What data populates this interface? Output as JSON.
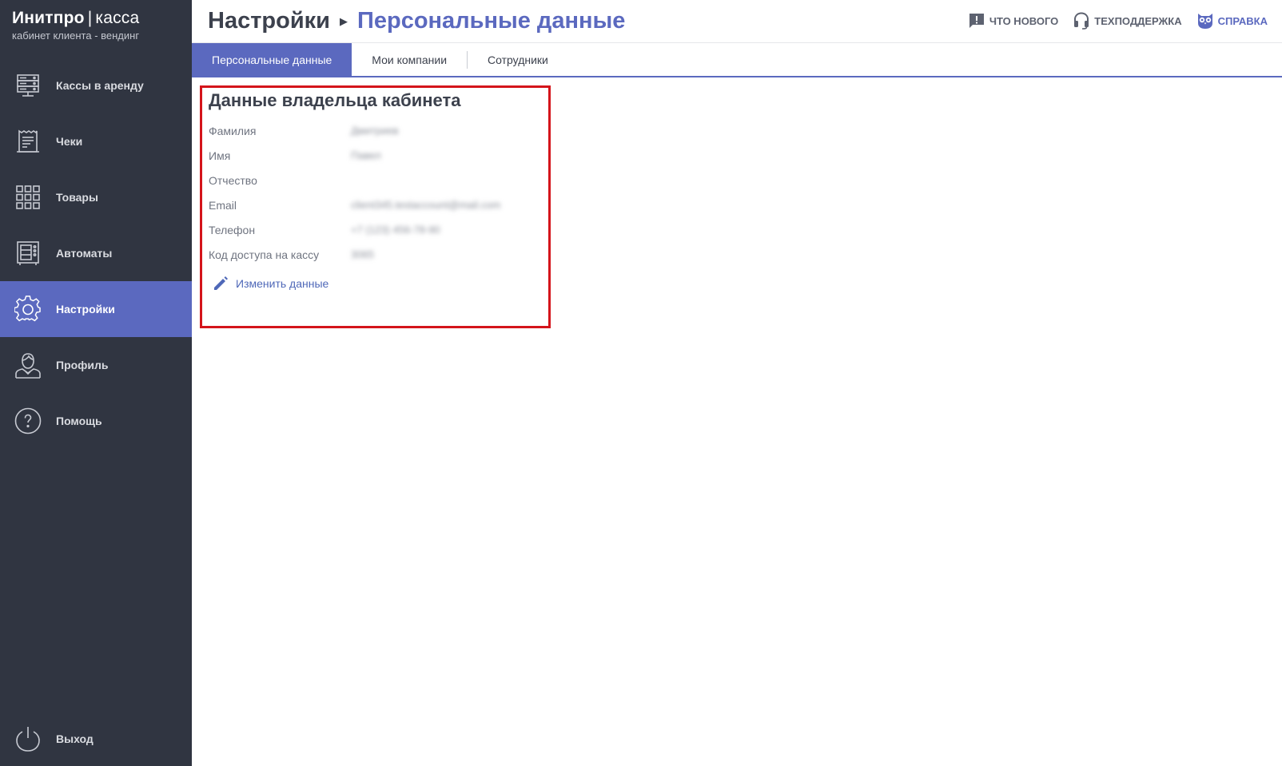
{
  "brand": {
    "name_bold": "Инитпро",
    "separator": "|",
    "name_light": "касса",
    "subtitle": "кабинет клиента - вендинг"
  },
  "sidebar": {
    "items": [
      {
        "label": "Кассы в аренду",
        "icon": "server-icon"
      },
      {
        "label": "Чеки",
        "icon": "receipt-icon"
      },
      {
        "label": "Товары",
        "icon": "grid-icon"
      },
      {
        "label": "Автоматы",
        "icon": "vending-machine-icon"
      },
      {
        "label": "Настройки",
        "icon": "gear-icon",
        "active": true
      },
      {
        "label": "Профиль",
        "icon": "user-icon"
      },
      {
        "label": "Помощь",
        "icon": "question-icon"
      }
    ],
    "logout": "Выход"
  },
  "header": {
    "root": "Настройки",
    "arrow": "›",
    "current": "Персональные данные",
    "links": {
      "whats_new": "ЧТО НОВОГО",
      "support": "ТЕХПОДДЕРЖКА",
      "help": "СПРАВКА"
    }
  },
  "tabs": [
    {
      "label": "Персональные данные",
      "active": true
    },
    {
      "label": "Мои компании"
    },
    {
      "label": "Сотрудники"
    }
  ],
  "card": {
    "title": "Данные владельца кабинета",
    "fields": [
      {
        "label": "Фамилия",
        "value": "Дмитриев"
      },
      {
        "label": "Имя",
        "value": "Павел"
      },
      {
        "label": "Отчество",
        "value": ""
      },
      {
        "label": "Email",
        "value": "client345.testaccount@mail.com"
      },
      {
        "label": "Телефон",
        "value": "+7 (123) 456-78-90"
      },
      {
        "label": "Код доступа на кассу",
        "value": "3065"
      }
    ],
    "edit_label": "Изменить данные"
  },
  "colors": {
    "sidebar_bg": "#303541",
    "accent": "#5b69bf",
    "highlight_border": "#d4141b"
  }
}
